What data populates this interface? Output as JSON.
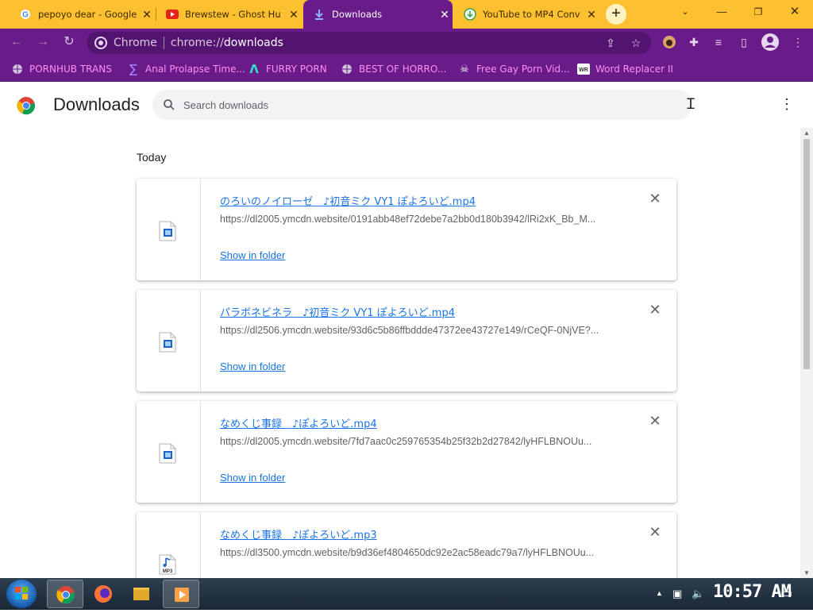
{
  "tabs": [
    {
      "title": "pepoyo dear - Google",
      "icon": "google-icon"
    },
    {
      "title": "Brewstew - Ghost Hu",
      "icon": "youtube-icon"
    },
    {
      "title": "Downloads",
      "icon": "download-icon"
    },
    {
      "title": "YouTube to MP4 Conv",
      "icon": "converter-icon"
    }
  ],
  "new_tab_label": "+",
  "omnibox": {
    "label": "Chrome",
    "url_prefix": "chrome://",
    "url_host": "downloads"
  },
  "bookmarks": [
    {
      "label": "PORNHUB TRANS",
      "icon": "globe-icon"
    },
    {
      "label": "Anal Prolapse Time...",
      "icon": "sigma-icon"
    },
    {
      "label": "FURRY PORN",
      "icon": "lambda-icon"
    },
    {
      "label": "BEST OF HORRO...",
      "icon": "globe-icon"
    },
    {
      "label": "Free Gay Porn Vid...",
      "icon": "skull-icon"
    },
    {
      "label": "Word Replacer II",
      "icon": "wr-icon"
    }
  ],
  "page": {
    "title": "Downloads",
    "search_placeholder": "Search downloads",
    "section": "Today"
  },
  "downloads": [
    {
      "name": "のろいのノイローゼ　♪初音ミク VY1 ぽよろいど.mp4",
      "url": "https://dl2005.ymcdn.website/0191abb48ef72debe7a2bb0d180b3942/lRi2xK_Bb_M...",
      "action": "Show in folder",
      "type": "video"
    },
    {
      "name": "パラボネビネラ　♪初音ミク VY1 ぽよろいど.mp4",
      "url": "https://dl2506.ymcdn.website/93d6c5b86ffbddde47372ee43727e149/rCeQF-0NjVE?...",
      "action": "Show in folder",
      "type": "video"
    },
    {
      "name": "なめくじ事録　♪ぽよろいど.mp4",
      "url": "https://dl2005.ymcdn.website/7fd7aac0c259765354b25f32b2d27842/lyHFLBNOUu...",
      "action": "Show in folder",
      "type": "video"
    },
    {
      "name": "なめくじ事録　♪ぽよろいど.mp3",
      "url": "https://dl3500.ymcdn.website/b9d36ef4804650dc92e2ac58eadc79a7/lyHFLBNOUu...",
      "action": "",
      "type": "mp3"
    }
  ],
  "mp3_label": "MP3",
  "taskbar": {
    "clock": "10:57 AM"
  },
  "colors": {
    "tab_strip": "#fdc030",
    "toolbar": "#6a1b8a",
    "bookmark_text": "#ff8ff0",
    "link": "#1a73e8"
  }
}
